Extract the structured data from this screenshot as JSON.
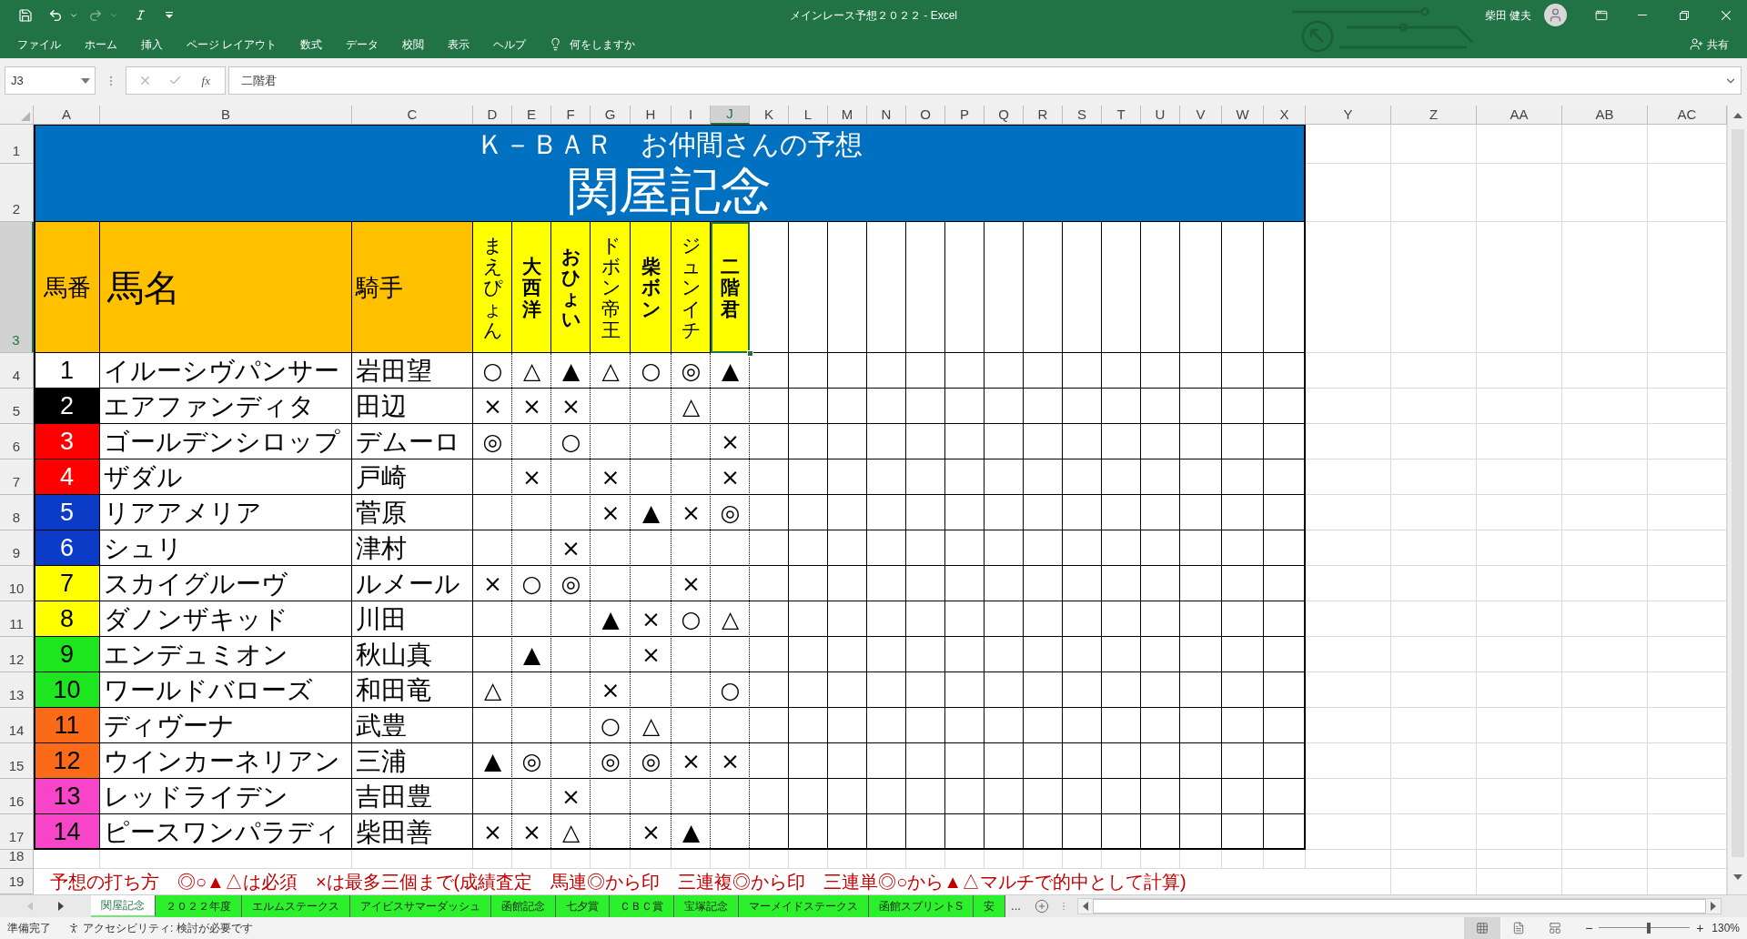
{
  "window": {
    "title": "メインレース予想２０２２ - Excel",
    "user": "柴田 健夫"
  },
  "ribbon": {
    "tabs": [
      {
        "label": "ファイル",
        "selected": false
      },
      {
        "label": "ホーム",
        "selected": false
      },
      {
        "label": "挿入",
        "selected": false
      },
      {
        "label": "ページ レイアウト",
        "selected": false
      },
      {
        "label": "数式",
        "selected": false
      },
      {
        "label": "データ",
        "selected": false
      },
      {
        "label": "校閲",
        "selected": false
      },
      {
        "label": "表示",
        "selected": false
      },
      {
        "label": "ヘルプ",
        "selected": false
      }
    ],
    "tell_me": "何をしますか",
    "share": "共有"
  },
  "formula_bar": {
    "name_box": "J3",
    "function_button": "fx",
    "formula": "二階君"
  },
  "columns": [
    {
      "label": "A",
      "selected": false
    },
    {
      "label": "B",
      "selected": false
    },
    {
      "label": "C",
      "selected": false
    },
    {
      "label": "D",
      "selected": false
    },
    {
      "label": "E",
      "selected": false
    },
    {
      "label": "F",
      "selected": false
    },
    {
      "label": "G",
      "selected": false
    },
    {
      "label": "H",
      "selected": false
    },
    {
      "label": "I",
      "selected": false
    },
    {
      "label": "J",
      "selected": true
    },
    {
      "label": "K",
      "selected": false
    },
    {
      "label": "L",
      "selected": false
    },
    {
      "label": "M",
      "selected": false
    },
    {
      "label": "N",
      "selected": false
    },
    {
      "label": "O",
      "selected": false
    },
    {
      "label": "P",
      "selected": false
    },
    {
      "label": "Q",
      "selected": false
    },
    {
      "label": "R",
      "selected": false
    },
    {
      "label": "S",
      "selected": false
    },
    {
      "label": "T",
      "selected": false
    },
    {
      "label": "U",
      "selected": false
    },
    {
      "label": "V",
      "selected": false
    },
    {
      "label": "W",
      "selected": false
    },
    {
      "label": "X",
      "selected": false
    },
    {
      "label": "Y",
      "selected": false
    },
    {
      "label": "Z",
      "selected": false
    },
    {
      "label": "AA",
      "selected": false
    },
    {
      "label": "AB",
      "selected": false
    },
    {
      "label": "AC",
      "selected": false
    }
  ],
  "row_headers": [
    {
      "label": "1",
      "selected": false
    },
    {
      "label": "2",
      "selected": false
    },
    {
      "label": "3",
      "selected": true
    },
    {
      "label": "4",
      "selected": false
    },
    {
      "label": "5",
      "selected": false
    },
    {
      "label": "6",
      "selected": false
    },
    {
      "label": "7",
      "selected": false
    },
    {
      "label": "8",
      "selected": false
    },
    {
      "label": "9",
      "selected": false
    },
    {
      "label": "10",
      "selected": false
    },
    {
      "label": "11",
      "selected": false
    },
    {
      "label": "12",
      "selected": false
    },
    {
      "label": "13",
      "selected": false
    },
    {
      "label": "14",
      "selected": false
    },
    {
      "label": "15",
      "selected": false
    },
    {
      "label": "16",
      "selected": false
    },
    {
      "label": "17",
      "selected": false
    },
    {
      "label": "18",
      "selected": false
    },
    {
      "label": "19",
      "selected": false
    }
  ],
  "sheet": {
    "title": "Ｋ－ＢＡＲ　お仲間さんの予想",
    "race": "関屋記念",
    "headers": {
      "number": "馬番",
      "horse": "馬名",
      "jockey": "騎手"
    },
    "predictors": [
      {
        "name": "まえぴょん",
        "bold": false,
        "selected": false
      },
      {
        "name": "大西洋",
        "bold": true,
        "selected": false
      },
      {
        "name": "おひょい",
        "bold": true,
        "selected": false
      },
      {
        "name": "ドボン帝王",
        "bold": false,
        "selected": false
      },
      {
        "name": "柴ボン",
        "bold": true,
        "selected": false
      },
      {
        "name": "ジュンイチ",
        "bold": false,
        "selected": false
      },
      {
        "name": "二階君",
        "bold": true,
        "selected": true
      }
    ],
    "horses": [
      {
        "number": "1",
        "name": "イルーシヴパンサー",
        "jockey": "岩田望",
        "color": "#ffffff",
        "marks": [
          {
            "kind": "mark",
            "text": "○"
          },
          {
            "kind": "mark",
            "text": "△"
          },
          {
            "kind": "mark",
            "text": "▲"
          },
          {
            "kind": "mark",
            "text": "△"
          },
          {
            "kind": "mark",
            "text": "○"
          },
          {
            "kind": "mark",
            "text": "◎"
          },
          {
            "kind": "mark",
            "text": "▲"
          }
        ]
      },
      {
        "number": "2",
        "name": "エアファンディタ",
        "jockey": "田辺",
        "color": "#000000",
        "marks": [
          {
            "kind": "mark",
            "text": "×"
          },
          {
            "kind": "mark",
            "text": "×"
          },
          {
            "kind": "mark",
            "text": "×"
          },
          {
            "kind": "blank"
          },
          {
            "kind": "blank"
          },
          {
            "kind": "mark",
            "text": "△"
          },
          {
            "kind": "blank"
          }
        ]
      },
      {
        "number": "3",
        "name": "ゴールデンシロップ",
        "jockey": "デムーロ",
        "color": "#ff0000",
        "marks": [
          {
            "kind": "mark",
            "text": "◎"
          },
          {
            "kind": "blank"
          },
          {
            "kind": "mark",
            "text": "○"
          },
          {
            "kind": "blank"
          },
          {
            "kind": "blank"
          },
          {
            "kind": "blank"
          },
          {
            "kind": "mark",
            "text": "×"
          }
        ]
      },
      {
        "number": "4",
        "name": "ザダル",
        "jockey": "戸崎",
        "color": "#ff0000",
        "marks": [
          {
            "kind": "blank"
          },
          {
            "kind": "mark",
            "text": "×"
          },
          {
            "kind": "blank"
          },
          {
            "kind": "mark",
            "text": "×"
          },
          {
            "kind": "blank"
          },
          {
            "kind": "blank"
          },
          {
            "kind": "mark",
            "text": "×"
          }
        ]
      },
      {
        "number": "5",
        "name": "リアアメリア",
        "jockey": "菅原",
        "color": "#0a3cc8",
        "marks": [
          {
            "kind": "blank"
          },
          {
            "kind": "blank"
          },
          {
            "kind": "blank"
          },
          {
            "kind": "mark",
            "text": "×"
          },
          {
            "kind": "mark",
            "text": "▲"
          },
          {
            "kind": "mark",
            "text": "×"
          },
          {
            "kind": "mark",
            "text": "◎"
          }
        ]
      },
      {
        "number": "6",
        "name": "シュリ",
        "jockey": "津村",
        "color": "#0a3cc8",
        "marks": [
          {
            "kind": "blank"
          },
          {
            "kind": "blank"
          },
          {
            "kind": "mark",
            "text": "×"
          },
          {
            "kind": "blank"
          },
          {
            "kind": "blank"
          },
          {
            "kind": "blank"
          },
          {
            "kind": "blank"
          }
        ]
      },
      {
        "number": "7",
        "name": "スカイグルーヴ",
        "jockey": "ルメール",
        "color": "#ffff00",
        "marks": [
          {
            "kind": "mark",
            "text": "×"
          },
          {
            "kind": "mark",
            "text": "○"
          },
          {
            "kind": "mark",
            "text": "◎"
          },
          {
            "kind": "blank"
          },
          {
            "kind": "blank"
          },
          {
            "kind": "mark",
            "text": "×"
          },
          {
            "kind": "blank"
          }
        ]
      },
      {
        "number": "8",
        "name": "ダノンザキッド",
        "jockey": "川田",
        "color": "#ffff00",
        "marks": [
          {
            "kind": "blank"
          },
          {
            "kind": "blank"
          },
          {
            "kind": "blank"
          },
          {
            "kind": "mark",
            "text": "▲"
          },
          {
            "kind": "mark",
            "text": "×"
          },
          {
            "kind": "mark",
            "text": "○"
          },
          {
            "kind": "mark",
            "text": "△"
          }
        ]
      },
      {
        "number": "9",
        "name": "エンデュミオン",
        "jockey": "秋山真",
        "color": "#1ee61e",
        "marks": [
          {
            "kind": "blank"
          },
          {
            "kind": "mark",
            "text": "▲"
          },
          {
            "kind": "blank"
          },
          {
            "kind": "blank"
          },
          {
            "kind": "mark",
            "text": "×"
          },
          {
            "kind": "blank"
          },
          {
            "kind": "blank"
          }
        ]
      },
      {
        "number": "10",
        "name": "ワールドバローズ",
        "jockey": "和田竜",
        "color": "#1ee61e",
        "marks": [
          {
            "kind": "mark",
            "text": "△"
          },
          {
            "kind": "blank"
          },
          {
            "kind": "blank"
          },
          {
            "kind": "mark",
            "text": "×"
          },
          {
            "kind": "blank"
          },
          {
            "kind": "blank"
          },
          {
            "kind": "mark",
            "text": "○"
          }
        ]
      },
      {
        "number": "11",
        "name": "ディヴーナ",
        "jockey": "武豊",
        "color": "#fb6a16",
        "marks": [
          {
            "kind": "blank"
          },
          {
            "kind": "blank"
          },
          {
            "kind": "blank"
          },
          {
            "kind": "mark",
            "text": "○"
          },
          {
            "kind": "mark",
            "text": "△"
          },
          {
            "kind": "blank"
          },
          {
            "kind": "blank"
          }
        ]
      },
      {
        "number": "12",
        "name": "ウインカーネリアン",
        "jockey": "三浦",
        "color": "#fb6a16",
        "marks": [
          {
            "kind": "mark",
            "text": "▲"
          },
          {
            "kind": "mark",
            "text": "◎"
          },
          {
            "kind": "blank"
          },
          {
            "kind": "mark",
            "text": "◎"
          },
          {
            "kind": "mark",
            "text": "◎"
          },
          {
            "kind": "mark",
            "text": "×"
          },
          {
            "kind": "mark",
            "text": "×"
          }
        ]
      },
      {
        "number": "13",
        "name": "レッドライデン",
        "jockey": "吉田豊",
        "color": "#f844c8",
        "marks": [
          {
            "kind": "blank"
          },
          {
            "kind": "blank"
          },
          {
            "kind": "mark",
            "text": "×"
          },
          {
            "kind": "blank"
          },
          {
            "kind": "blank"
          },
          {
            "kind": "blank"
          },
          {
            "kind": "blank"
          }
        ]
      },
      {
        "number": "14",
        "name": "ピースワンパラディ",
        "jockey": "柴田善",
        "color": "#f844c8",
        "marks": [
          {
            "kind": "mark",
            "text": "×"
          },
          {
            "kind": "mark",
            "text": "×"
          },
          {
            "kind": "mark",
            "text": "△"
          },
          {
            "kind": "blank"
          },
          {
            "kind": "mark",
            "text": "×"
          },
          {
            "kind": "mark",
            "text": "▲"
          },
          {
            "kind": "blank"
          }
        ]
      }
    ],
    "note": "予想の打ち方　◎○▲△は必須　×は最多三個まで(成績査定　馬連◎から印　三連複◎から印　三連単◎○から▲△マルチで的中として計算)"
  },
  "sheet_tabs": {
    "tabs": [
      {
        "label": "関屋記念",
        "selected": true
      },
      {
        "label": "２０２２年度",
        "selected": false
      },
      {
        "label": "エルムステークス",
        "selected": false
      },
      {
        "label": "アイビスサマーダッシュ",
        "selected": false
      },
      {
        "label": "函館記念",
        "selected": false
      },
      {
        "label": "七夕賞",
        "selected": false
      },
      {
        "label": "ＣＢＣ賞",
        "selected": false
      },
      {
        "label": "宝塚記念",
        "selected": false
      },
      {
        "label": "マーメイドステークス",
        "selected": false
      },
      {
        "label": "函館スプリントS",
        "selected": false
      },
      {
        "label": "安",
        "selected": false
      }
    ],
    "more": "..."
  },
  "status_bar": {
    "status": "準備完了",
    "accessibility": "アクセシビリティ: 検討が必要です",
    "views": [
      {
        "kind": "normal",
        "selected": true
      },
      {
        "kind": "page_layout",
        "selected": false
      },
      {
        "kind": "page_break_preview",
        "selected": false
      }
    ],
    "zoom": {
      "minus": "−",
      "plus": "+",
      "level": 0.55,
      "label": "130%"
    }
  }
}
